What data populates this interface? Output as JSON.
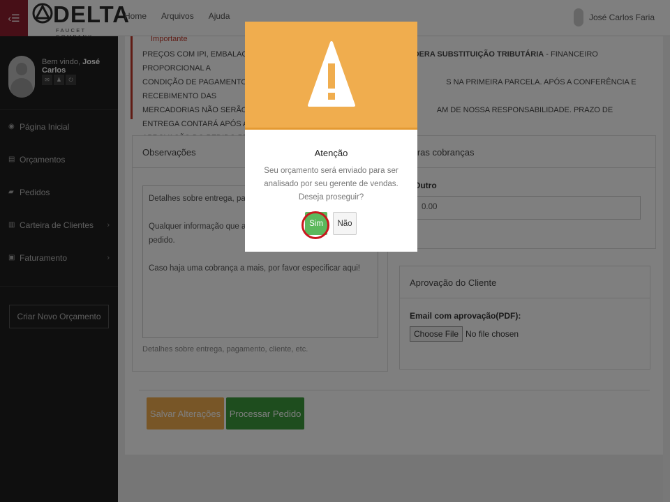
{
  "brand": {
    "name": "DELTA",
    "subtitle": "FAUCET COMPANY"
  },
  "topnav": [
    "Home",
    "Arquivos",
    "Ajuda"
  ],
  "user": {
    "name": "José Carlos Faria"
  },
  "sidebar": {
    "welcome_prefix": "Bem vindo,",
    "welcome_name": "José Carlos",
    "items": [
      {
        "label": "Página Inicial",
        "icon": "dashboard-icon"
      },
      {
        "label": "Orçamentos",
        "icon": "document-icon"
      },
      {
        "label": "Pedidos",
        "icon": "truck-icon"
      },
      {
        "label": "Carteira de Clientes",
        "icon": "book-icon",
        "chevron": "›"
      },
      {
        "label": "Faturamento",
        "icon": "money-icon",
        "chevron": "›"
      }
    ],
    "create_button": "Criar Novo Orçamento"
  },
  "notice": {
    "title": "Importante",
    "line1": "PREÇOS COM IPI, EMBALAGEM, ICM",
    "line1_bold": "CONSIDERA SUBSTITUIÇÃO TRIBUTÁRIA",
    "line1_end": " - FINANCEIRO PROPORCIONAL A",
    "line2a": "CONDIÇÃO DE PAGAMENTO. PARA",
    "line2b": "S NA PRIMEIRA PARCELA. APÓS A CONFERÊNCIA E RECEBIMENTO DAS",
    "line3a": "MERCADORIAS NÃO SERÃO ACEITA",
    "line3b": "AM DE NOSSA RESPONSABILIDADE. PRAZO DE ENTREGA CONTARÁ APÓS A",
    "line4": "APROVAÇÃO DO PEDIDO PELA DEL"
  },
  "observacoes": {
    "title": "Observações",
    "text_lines": [
      "Detalhes sobre entrega, pagame",
      "",
      "Qualquer informação que ajudar",
      "pedido.",
      "",
      "Caso haja uma cobrança a mais, por favor especificar aqui!"
    ],
    "help": "Detalhes sobre entrega, pagamento, cliente, etc."
  },
  "outras": {
    "title": "utras cobranças",
    "label": "Outro",
    "value": "0.00"
  },
  "aprovacao": {
    "title": "Aprovação do Cliente",
    "label": "Email com aprovação(PDF):",
    "file_button": "Choose File",
    "file_status": "No file chosen"
  },
  "actions": {
    "save": "Salvar Alterações",
    "process": "Processar Pedido"
  },
  "modal": {
    "title": "Atenção",
    "message": "Seu orçamento será enviado para ser analisado por seu gerente de vendas. Deseja proseguir?",
    "confirm": "Sim",
    "cancel": "Não",
    "accent_color": "#f0ad4e"
  }
}
